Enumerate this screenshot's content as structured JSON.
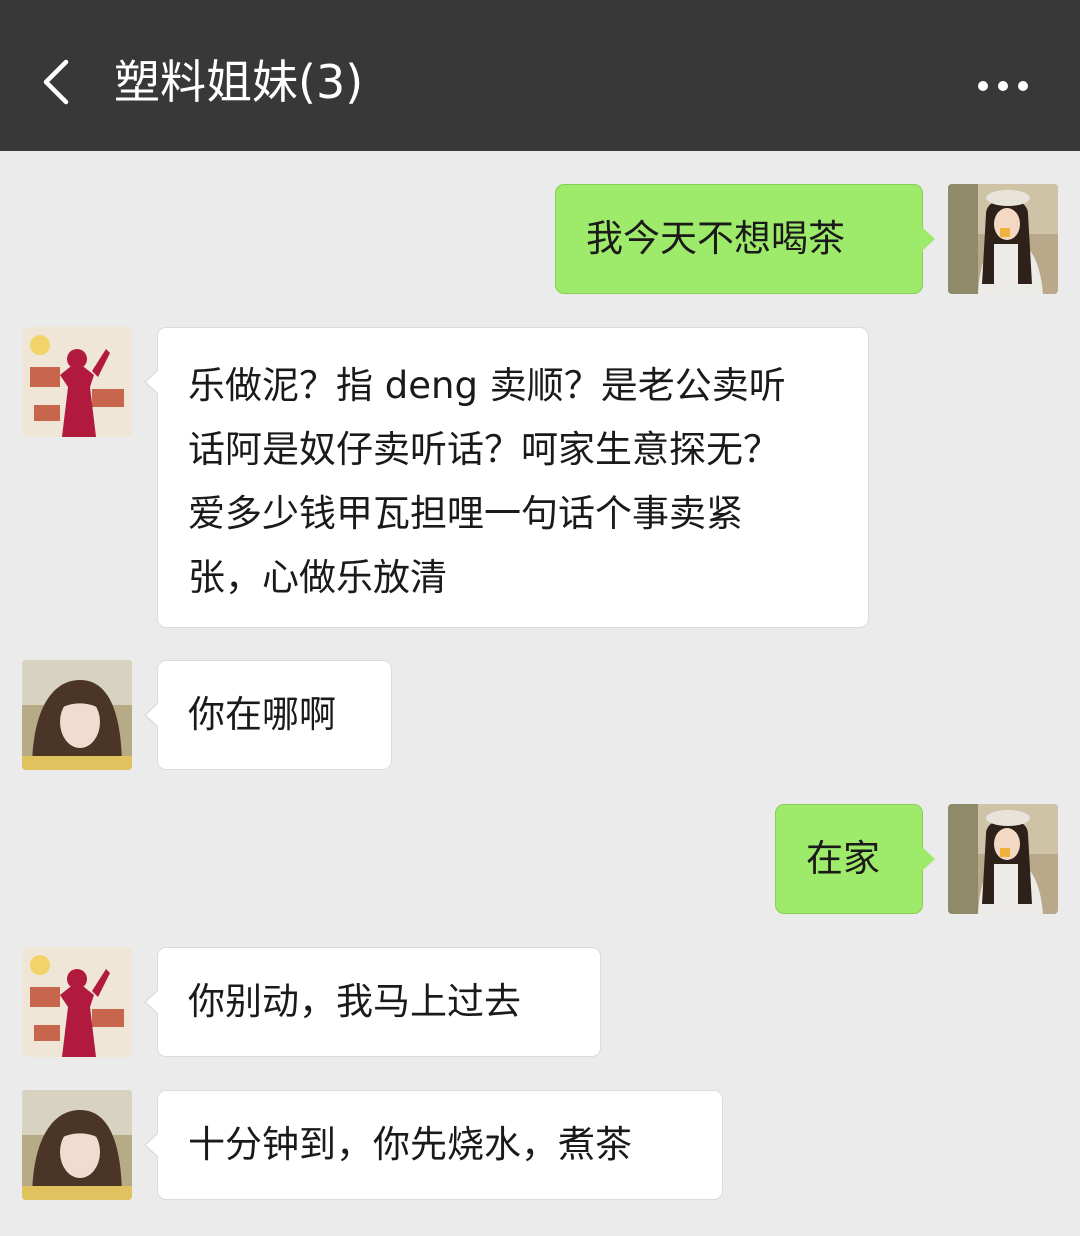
{
  "header": {
    "title": "塑料姐妹(3)",
    "back_icon": "chevron-left-icon",
    "more_icon": "more-dots-icon",
    "bg_color": "#383838"
  },
  "colors": {
    "chat_bg": "#ebebeb",
    "outgoing_bubble": "#9eea6a",
    "incoming_bubble": "#ffffff"
  },
  "messages": [
    {
      "direction": "outgoing",
      "sender": "self",
      "text": "我今天不想喝茶"
    },
    {
      "direction": "incoming",
      "sender": "member-a",
      "lines": [
        "乐做泥？指 deng 卖顺？是老公卖听",
        "话阿是奴仔卖听话？呵家生意探无？",
        "爱多少钱甲瓦担哩一句话个事卖紧",
        "张，心做乐放清"
      ]
    },
    {
      "direction": "incoming",
      "sender": "member-b",
      "text": "你在哪啊"
    },
    {
      "direction": "outgoing",
      "sender": "self",
      "text": "在家"
    },
    {
      "direction": "incoming",
      "sender": "member-a",
      "text": "你别动，我马上过去"
    },
    {
      "direction": "incoming",
      "sender": "member-b",
      "text": "十分钟到，你先烧水，煮茶"
    }
  ]
}
